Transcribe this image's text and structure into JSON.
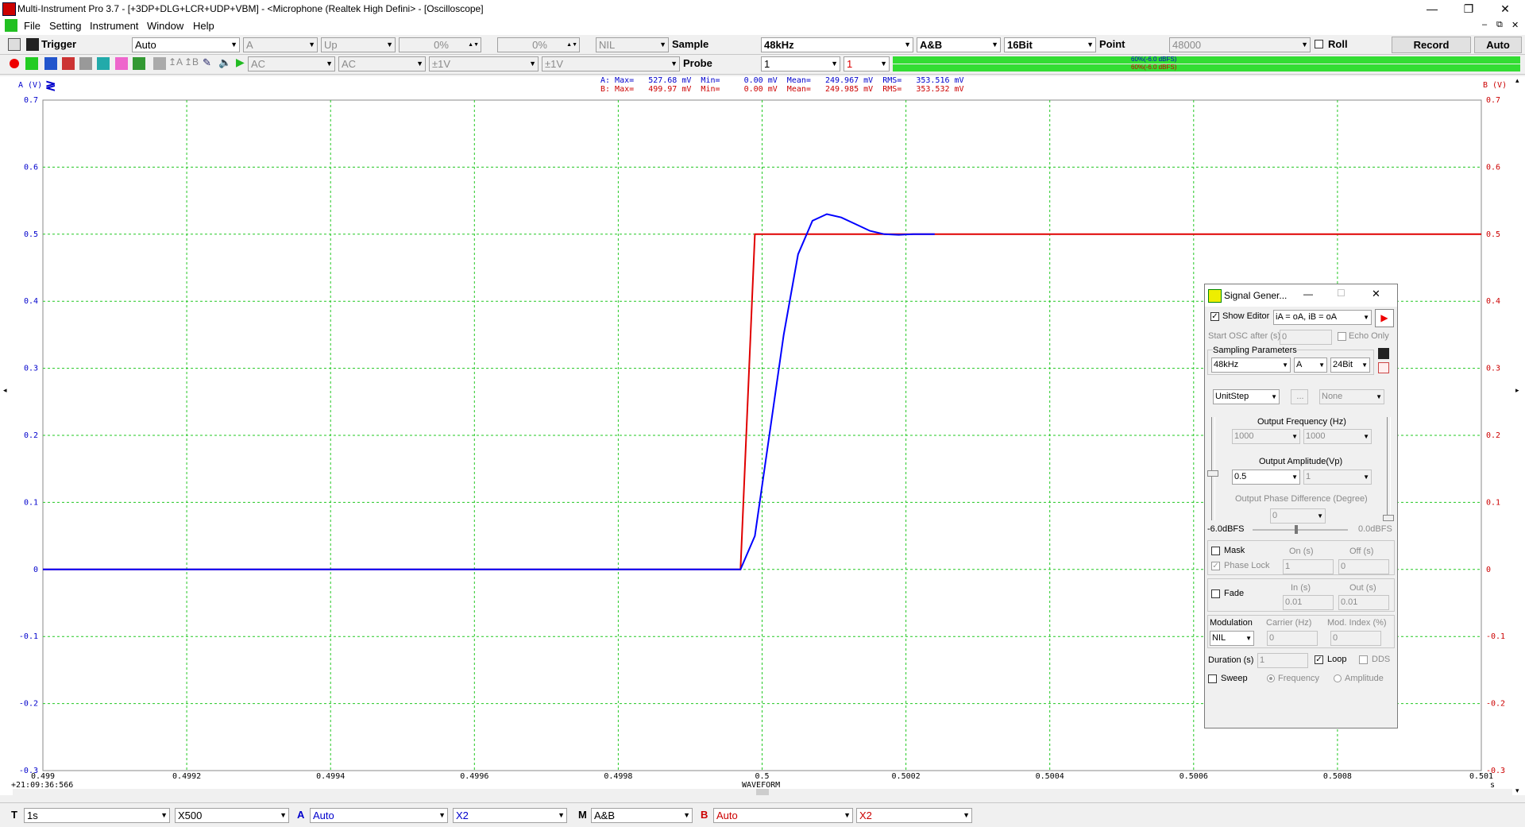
{
  "window": {
    "title": "Multi-Instrument Pro 3.7   -   [+3DP+DLG+LCR+UDP+VBM]   -   <Microphone (Realtek High Defini> - [Oscilloscope]",
    "minimize": "—",
    "restore": "❐",
    "close": "✕",
    "mdi_min": "–",
    "mdi_restore": "⧉",
    "mdi_close": "✕"
  },
  "menu": [
    "File",
    "Setting",
    "Instrument",
    "Window",
    "Help"
  ],
  "toolbar1": {
    "trigger_label": "Trigger",
    "trigger_mode": "Auto",
    "trigger_source": "A",
    "trigger_edge": "Up",
    "trigger_level": "0%",
    "trigger_delay": "0%",
    "filter": "NIL",
    "sample_label": "Sample",
    "sample_rate": "48kHz",
    "channels": "A&B",
    "bits": "16Bit",
    "point_label": "Point",
    "points": "48000",
    "roll_label": "Roll",
    "record_label": "Record",
    "auto_label": "Auto"
  },
  "toolbar2": {
    "coupling_a": "AC",
    "coupling_b": "AC",
    "range": "±1V",
    "probe_label": "Probe",
    "probe_a": "1",
    "probe_b": "1",
    "level_a": "60%(-6.0 dBFS)",
    "level_b": "60%(-6.0 dBFS)"
  },
  "scope": {
    "a_axis_label": "A (V)",
    "b_axis_label": "B (V)",
    "stats_a": "A: Max=   527.68 mV  Min=     0.00 mV  Mean=   249.967 mV  RMS=   353.516 mV",
    "stats_b": "B: Max=   499.97 mV  Min=     0.00 mV  Mean=   249.985 mV  RMS=   353.532 mV",
    "timestamp": "+21:09:36:566",
    "x_axis_title": "WAVEFORM",
    "x_unit": "s",
    "y_ticks": [
      "0.7",
      "0.6",
      "0.5",
      "0.4",
      "0.3",
      "0.2",
      "0.1",
      "0",
      "-0.1",
      "-0.2",
      "-0.3"
    ],
    "x_ticks": [
      "0.499",
      "0.4992",
      "0.4994",
      "0.4996",
      "0.4998",
      "0.5",
      "0.5002",
      "0.5004",
      "0.5006",
      "0.5008",
      "0.501"
    ]
  },
  "chart_data": {
    "type": "line",
    "xlabel": "WAVEFORM",
    "ylabel": "A (V)",
    "xlim": [
      0.499,
      0.501
    ],
    "ylim": [
      -0.3,
      0.7
    ],
    "grid": true,
    "series": [
      {
        "name": "A",
        "color": "#0000ff",
        "x": [
          0.499,
          0.49997,
          0.49999,
          0.50001,
          0.50003,
          0.50005,
          0.50007,
          0.50009,
          0.50011,
          0.50013,
          0.50015,
          0.50017,
          0.50019,
          0.50021,
          0.50024
        ],
        "y": [
          0,
          0,
          0.05,
          0.2,
          0.35,
          0.47,
          0.52,
          0.53,
          0.525,
          0.515,
          0.505,
          0.5,
          0.499,
          0.5,
          0.5
        ]
      },
      {
        "name": "B",
        "color": "#e00000",
        "x": [
          0.499,
          0.49997,
          0.49999,
          0.50001,
          0.501
        ],
        "y": [
          0,
          0,
          0.5,
          0.5,
          0.5
        ]
      }
    ]
  },
  "bottombar": {
    "t_label": "T",
    "timebase": "1s",
    "x_zoom": "X500",
    "a_label": "A",
    "a_scale": "Auto",
    "a_zoom": "X2",
    "m_label": "M",
    "m_mode": "A&B",
    "b_label": "B",
    "b_scale": "Auto",
    "b_zoom": "X2"
  },
  "siggen": {
    "title": "Signal Gener...",
    "show_editor": "Show Editor",
    "editor_expr": "iA = oA, iB = oA",
    "start_osc": "Start OSC after (s)",
    "start_osc_value": "0",
    "echo_only": "Echo Only",
    "sampling_params": "Sampling Parameters",
    "rate": "48kHz",
    "channel": "A",
    "bits": "24Bit",
    "waveform": "UnitStep",
    "ellipsis": "...",
    "secondary": "None",
    "out_freq_label": "Output Frequency (Hz)",
    "freq_a": "1000",
    "freq_b": "1000",
    "out_amp_label": "Output Amplitude(Vp)",
    "amp_a": "0.5",
    "amp_b": "1",
    "phase_label": "Output Phase Difference (Degree)",
    "phase": "0",
    "dbfs_left": "-6.0dBFS",
    "dbfs_right": "0.0dBFS",
    "mask": "Mask",
    "on_label": "On (s)",
    "off_label": "Off (s)",
    "phase_lock": "Phase Lock",
    "on_value": "1",
    "off_value": "0",
    "fade": "Fade",
    "in_label": "In (s)",
    "out_label": "Out (s)",
    "in_value": "0.01",
    "out_value": "0.01",
    "modulation": "Modulation",
    "carrier_label": "Carrier (Hz)",
    "mod_index_label": "Mod. Index (%)",
    "modulation_value": "NIL",
    "carrier_value": "0",
    "mod_index_value": "0",
    "duration_label": "Duration (s)",
    "duration_value": "1",
    "loop": "Loop",
    "dds": "DDS",
    "sweep": "Sweep",
    "frequency": "Frequency",
    "amplitude": "Amplitude"
  }
}
